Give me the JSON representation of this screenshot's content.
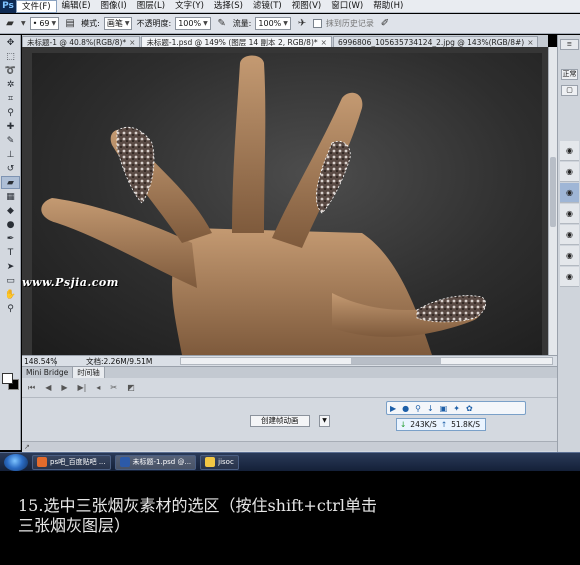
{
  "menubar": {
    "logo": "Ps",
    "items": [
      "文件(F)",
      "编辑(E)",
      "图像(I)",
      "图层(L)",
      "文字(Y)",
      "选择(S)",
      "滤镜(T)",
      "视图(V)",
      "窗口(W)",
      "帮助(H)"
    ]
  },
  "options": {
    "brush_size": "69",
    "mode_label": "模式:",
    "mode_value": "画笔",
    "opacity_label": "不透明度:",
    "opacity_value": "100%",
    "flow_label": "流量:",
    "flow_value": "100%",
    "history_label": "抹到历史记录"
  },
  "tabs": [
    {
      "label": "未标题-1 @ 40.8%(RGB/8)*"
    },
    {
      "label": "未标题-1.psd @ 149% (图层 14 副本 2, RGB/8)*"
    },
    {
      "label": "6996806_105635734124_2.jpg @ 143%(RGB/8#)"
    }
  ],
  "canvas": {
    "watermark": "www.Psjia.com"
  },
  "status": {
    "zoom": "148.54%",
    "doc_info": "文档:2.26M/9.51M"
  },
  "bottom_panel": {
    "tabs": [
      "Mini Bridge",
      "时间轴"
    ],
    "create_animation": "创建帧动画"
  },
  "right_panel": {
    "top_tab": "正常",
    "button_label": "正常"
  },
  "net_widget": {
    "down_speed": "243K/S",
    "up_speed": "51.8K/S"
  },
  "taskbar": {
    "tasks": [
      "ps吧_百度贴吧 ...",
      "未标题-1.psd @...",
      "jisoc"
    ]
  },
  "caption": "15.选中三张烟灰素材的选区（按住shift+ctrl单击\n三张烟灰图层）"
}
